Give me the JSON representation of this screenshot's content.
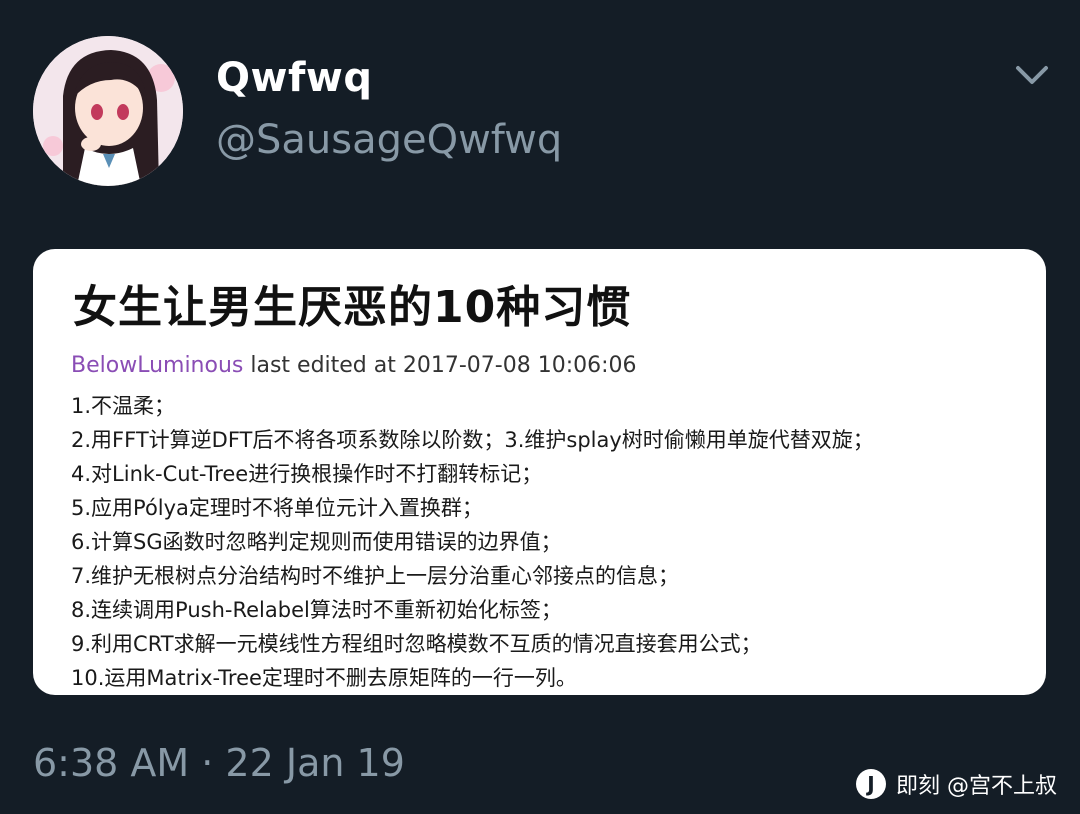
{
  "tweet": {
    "display_name": "Qwfwq",
    "handle": "@SausageQwfwq",
    "timestamp": "6:38 AM · 22 Jan 19",
    "menu_icon": "chevron-down-icon"
  },
  "card": {
    "title": "女生让男生厌恶的10种习惯",
    "meta_user": "BelowLuminous",
    "meta_text": " last edited at 2017-07-08 10:06:06",
    "lines": [
      "1.不温柔；",
      "2.用FFT计算逆DFT后不将各项系数除以阶数；3.维护splay树时偷懒用单旋代替双旋；",
      "4.对Link-Cut-Tree进行换根操作时不打翻转标记；",
      "5.应用Pólya定理时不将单位元计入置换群；",
      "6.计算SG函数时忽略判定规则而使用错误的边界值；",
      "7.维护无根树点分治结构时不维护上一层分治重心邻接点的信息；",
      "8.连续调用Push-Relabel算法时不重新初始化标签；",
      "9.利用CRT求解一元模线性方程组时忽略模数不互质的情况直接套用公式；",
      "10.运用Matrix-Tree定理时不删去原矩阵的一行一列。"
    ]
  },
  "watermark": {
    "logo_glyph": "J",
    "text": "即刻 @宫不上叔"
  },
  "colors": {
    "background": "#141d26",
    "muted": "#8899a6",
    "username_accent": "#8a4db5"
  }
}
